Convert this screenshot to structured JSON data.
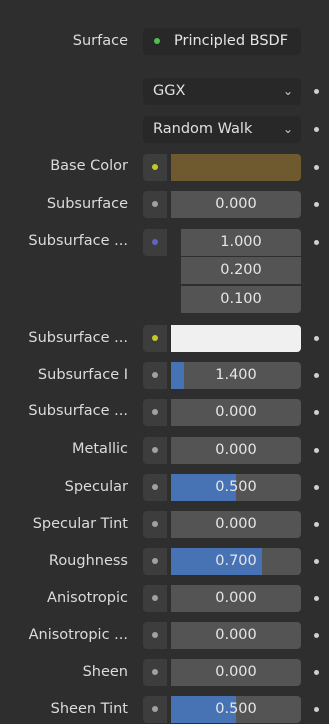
{
  "colors": {
    "background": "#2e2e2e",
    "field": "#545454",
    "slider_fill": "#4772b3",
    "shader_socket": "#4ec04e",
    "color_socket": "#c7c729",
    "float_socket": "#a1a1a1",
    "vector_socket": "#6363c7",
    "base_color_swatch": "#6f5a30",
    "white_swatch": "#f0f0f0"
  },
  "surface": {
    "label": "Surface",
    "value": "Principled BSDF",
    "socket_icon": "shader-socket"
  },
  "distribution": {
    "value": "GGX",
    "chevron": "⌄"
  },
  "subsurface_method": {
    "value": "Random Walk",
    "chevron": "⌄"
  },
  "rows": {
    "base_color": {
      "label": "Base Color"
    },
    "subsurface": {
      "label": "Subsurface",
      "value": "0.000",
      "level": 0
    },
    "subsurface_radius": {
      "label": "Subsurface ...",
      "values": [
        "1.000",
        "0.200",
        "0.100"
      ]
    },
    "subsurface_color": {
      "label": "Subsurface ..."
    },
    "subsurface_ior": {
      "label": "Subsurface I",
      "value": "1.400",
      "level": 0.1
    },
    "subsurface_aniso": {
      "label": "Subsurface ...",
      "value": "0.000",
      "level": 0
    },
    "metallic": {
      "label": "Metallic",
      "value": "0.000",
      "level": 0
    },
    "specular": {
      "label": "Specular",
      "value": "0.500",
      "level": 0.5
    },
    "specular_tint": {
      "label": "Specular Tint",
      "value": "0.000",
      "level": 0
    },
    "roughness": {
      "label": "Roughness",
      "value": "0.700",
      "level": 0.7
    },
    "anisotropic": {
      "label": "Anisotropic",
      "value": "0.000",
      "level": 0
    },
    "anisotropic_rotation": {
      "label": "Anisotropic ...",
      "value": "0.000",
      "level": 0
    },
    "sheen": {
      "label": "Sheen",
      "value": "0.000",
      "level": 0
    },
    "sheen_tint": {
      "label": "Sheen Tint",
      "value": "0.500",
      "level": 0.5
    }
  }
}
